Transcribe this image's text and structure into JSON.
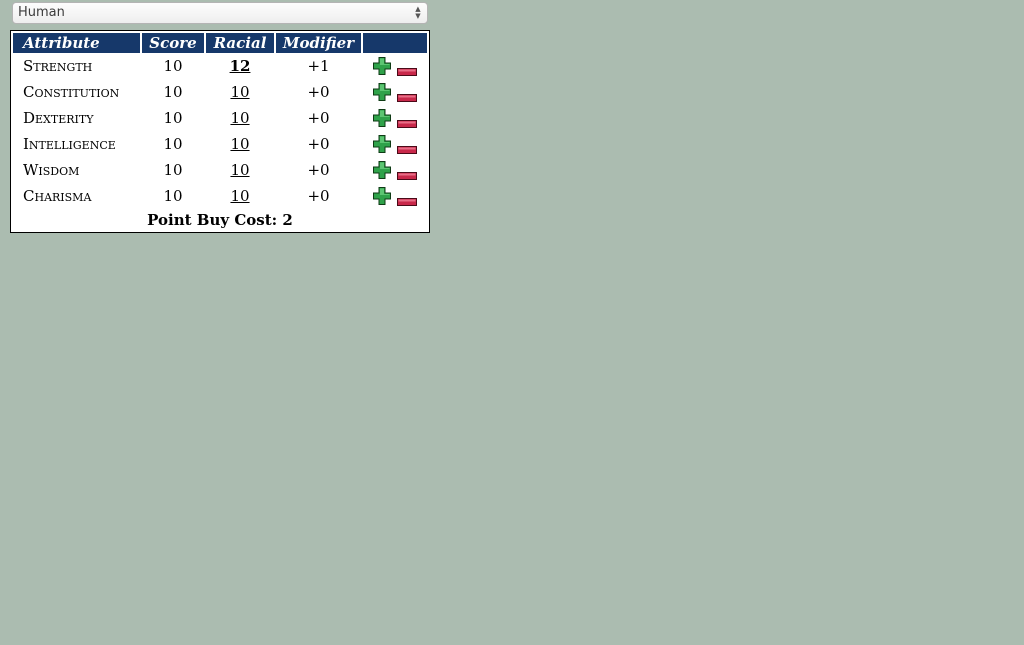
{
  "race_select": {
    "selected": "Human"
  },
  "table": {
    "headers": {
      "attribute": "Attribute",
      "score": "Score",
      "racial": "Racial",
      "modifier": "Modifier"
    },
    "rows": [
      {
        "name": "Strength",
        "score": "10",
        "racial": "12",
        "modifier": "+1",
        "boosted": true
      },
      {
        "name": "Constitution",
        "score": "10",
        "racial": "10",
        "modifier": "+0",
        "boosted": false
      },
      {
        "name": "Dexterity",
        "score": "10",
        "racial": "10",
        "modifier": "+0",
        "boosted": false
      },
      {
        "name": "Intelligence",
        "score": "10",
        "racial": "10",
        "modifier": "+0",
        "boosted": false
      },
      {
        "name": "Wisdom",
        "score": "10",
        "racial": "10",
        "modifier": "+0",
        "boosted": false
      },
      {
        "name": "Charisma",
        "score": "10",
        "racial": "10",
        "modifier": "+0",
        "boosted": false
      }
    ],
    "plus_icon": "plus-icon",
    "minus_icon": "minus-icon"
  },
  "point_buy": {
    "label": "Point Buy Cost: 2"
  },
  "colors": {
    "background": "#abbcb0",
    "header_bg": "#16386a",
    "plus_green": "#2fa24a",
    "minus_red": "#c8284a"
  }
}
